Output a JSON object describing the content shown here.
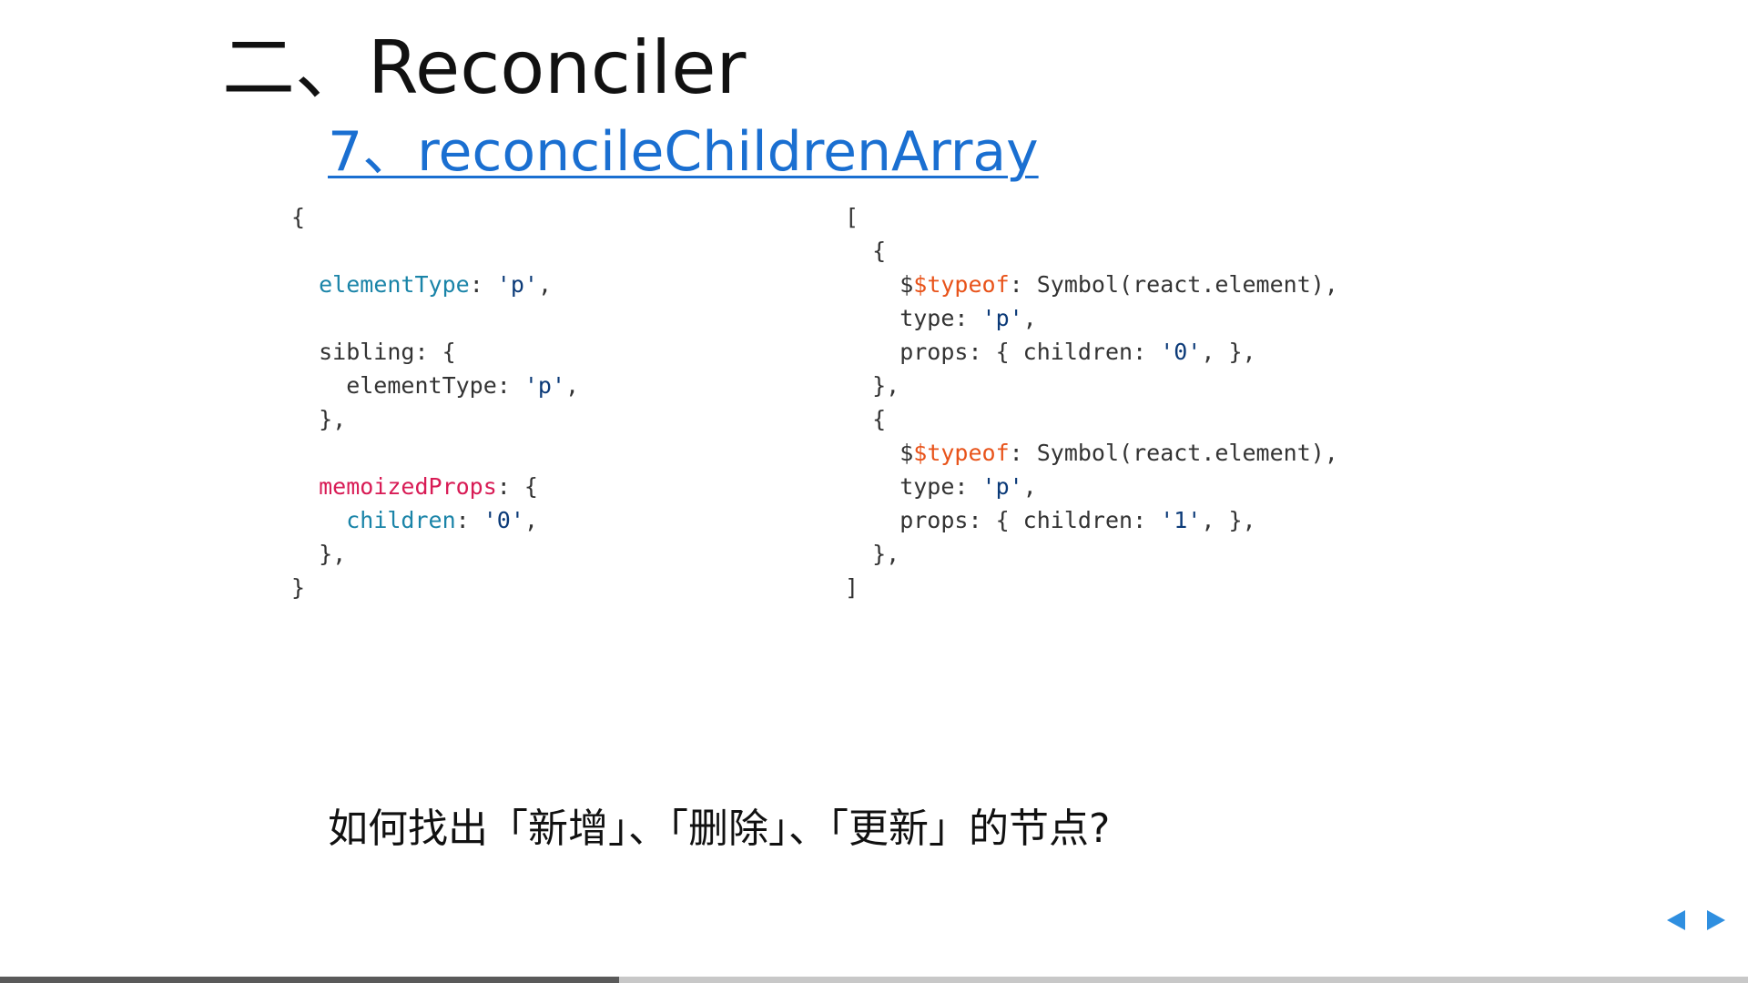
{
  "slide": {
    "title": "二、Reconciler",
    "subtitle": "7、reconcileChildrenArray",
    "question": "如何找出「新增」、「删除」、「更新」的节点?"
  },
  "code_left": {
    "lines": [
      [
        {
          "t": "{",
          "c": "plain"
        }
      ],
      [],
      [
        {
          "t": "  ",
          "c": "plain"
        },
        {
          "t": "elementType",
          "c": "prop-blue"
        },
        {
          "t": ": ",
          "c": "plain"
        },
        {
          "t": "'p'",
          "c": "str"
        },
        {
          "t": ",",
          "c": "plain"
        }
      ],
      [],
      [
        {
          "t": "  sibling: {",
          "c": "plain"
        }
      ],
      [
        {
          "t": "    elementType: ",
          "c": "plain"
        },
        {
          "t": "'p'",
          "c": "str"
        },
        {
          "t": ",",
          "c": "plain"
        }
      ],
      [
        {
          "t": "  },",
          "c": "plain"
        }
      ],
      [],
      [
        {
          "t": "  ",
          "c": "plain"
        },
        {
          "t": "memoizedProps",
          "c": "prop-red"
        },
        {
          "t": ": {",
          "c": "plain"
        }
      ],
      [
        {
          "t": "    ",
          "c": "plain"
        },
        {
          "t": "children",
          "c": "prop-blue"
        },
        {
          "t": ": ",
          "c": "plain"
        },
        {
          "t": "'0'",
          "c": "str"
        },
        {
          "t": ",",
          "c": "plain"
        }
      ],
      [
        {
          "t": "  },",
          "c": "plain"
        }
      ],
      [
        {
          "t": "}",
          "c": "plain"
        }
      ]
    ]
  },
  "code_right": {
    "lines": [
      [
        {
          "t": "[",
          "c": "plain"
        }
      ],
      [
        {
          "t": "  {",
          "c": "plain"
        }
      ],
      [
        {
          "t": "    $",
          "c": "plain"
        },
        {
          "t": "$typeof",
          "c": "orange"
        },
        {
          "t": ": Symbol(react.element),",
          "c": "plain"
        }
      ],
      [
        {
          "t": "    type: ",
          "c": "plain"
        },
        {
          "t": "'p'",
          "c": "str"
        },
        {
          "t": ",",
          "c": "plain"
        }
      ],
      [
        {
          "t": "    props: { children: ",
          "c": "plain"
        },
        {
          "t": "'0'",
          "c": "str"
        },
        {
          "t": ", },",
          "c": "plain"
        }
      ],
      [
        {
          "t": "  },",
          "c": "plain"
        }
      ],
      [
        {
          "t": "  {",
          "c": "plain"
        }
      ],
      [
        {
          "t": "    $",
          "c": "plain"
        },
        {
          "t": "$typeof",
          "c": "orange"
        },
        {
          "t": ": Symbol(react.element),",
          "c": "plain"
        }
      ],
      [
        {
          "t": "    type: ",
          "c": "plain"
        },
        {
          "t": "'p'",
          "c": "str"
        },
        {
          "t": ",",
          "c": "plain"
        }
      ],
      [
        {
          "t": "    props: { children: ",
          "c": "plain"
        },
        {
          "t": "'1'",
          "c": "str"
        },
        {
          "t": ", },",
          "c": "plain"
        }
      ],
      [
        {
          "t": "  },",
          "c": "plain"
        }
      ],
      [
        {
          "t": "]",
          "c": "plain"
        }
      ]
    ]
  },
  "navigation": {
    "prev_icon": "triangle-left-icon",
    "next_icon": "triangle-right-icon",
    "arrow_color": "#2f8fe0"
  },
  "progress": {
    "fraction": 0.354
  },
  "colors": {
    "link": "#1a6fd1",
    "prop_blue": "#1a84a8",
    "prop_red": "#d81b55",
    "string": "#0b3a78",
    "keyword_orange": "#e8531a"
  }
}
